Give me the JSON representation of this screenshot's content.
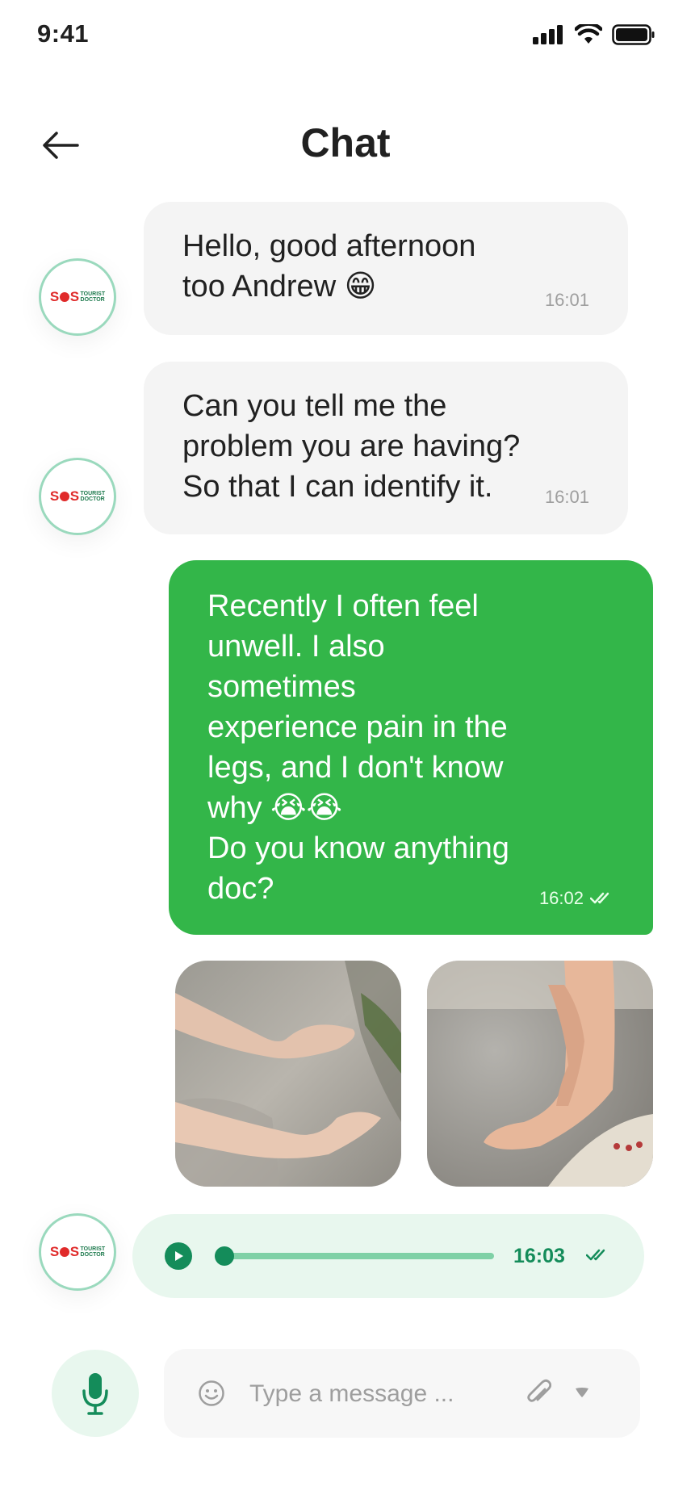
{
  "status_bar": {
    "time": "9:41"
  },
  "header": {
    "title": "Chat"
  },
  "messages": [
    {
      "text_line1": "Hello, good afternoon",
      "text_line2": "too Andrew 😁",
      "time": "16:01"
    },
    {
      "text_line1": "Can you tell me the",
      "text_line2": "problem you are having?",
      "text_line3": "So that I can identify it.",
      "time": "16:01"
    },
    {
      "lines": [
        "Recently I often feel",
        "unwell. I also",
        "sometimes",
        "experience pain in the",
        "legs, and I don't know",
        "why 😭😭",
        "Do you know anything",
        "doc?"
      ],
      "time": "16:02",
      "read": true
    }
  ],
  "avatar": {
    "brand_sos": "SOS",
    "brand_line1": "TOURIST",
    "brand_line2": "DOCTOR"
  },
  "photos": [
    {
      "alt": "legs-photo"
    },
    {
      "alt": "feet-photo"
    }
  ],
  "voice_message": {
    "time": "16:03",
    "progress": 0.0
  },
  "composer": {
    "placeholder": "Type a message ..."
  },
  "colors": {
    "accent_green": "#33b649",
    "dark_green": "#148c5a",
    "light_green": "#e8f7ee",
    "bubble_gray": "#f4f4f4"
  },
  "icons": [
    "back-arrow-icon",
    "signal-icon",
    "wifi-icon",
    "battery-icon",
    "play-icon",
    "double-check-icon",
    "emoji-icon",
    "attach-icon",
    "dropdown-icon",
    "mic-icon"
  ]
}
